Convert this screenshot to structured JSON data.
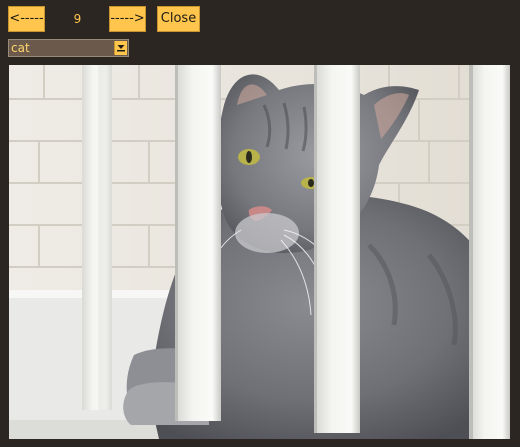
{
  "toolbar": {
    "prev_label": "<-----",
    "index_value": "9",
    "next_label": "----->",
    "close_label": "Close"
  },
  "category_select": {
    "selected_value": "cat"
  },
  "colors": {
    "background": "#2b2622",
    "button_fill": "#ffc54d",
    "counter_text": "#ffc54d",
    "select_fill": "#6b5a4c"
  },
  "icons": {
    "dropdown": "chevron-down-icon"
  }
}
